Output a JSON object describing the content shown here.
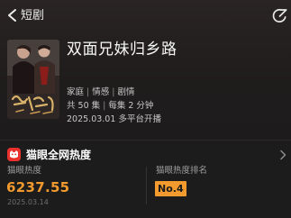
{
  "nav": {
    "title": "短剧"
  },
  "drama": {
    "title": "双面兄妹归乡路",
    "genres": [
      "家庭",
      "情感",
      "剧情"
    ],
    "episodes": "共 50 集",
    "duration": "每集 2 分钟",
    "release_date": "2025.03.01",
    "release_platform": "多平台开播"
  },
  "heat": {
    "section_title": "猫眼全网热度",
    "label_heat": "猫眼热度",
    "heat_value": "6237.55",
    "heat_date": "2025.03.14",
    "label_rank": "猫眼热度排名",
    "rank_value": "No.4"
  },
  "icons": {
    "back": "chevron-left-icon",
    "share": "share-icon",
    "logo": "maoyan-logo-icon",
    "more": "chevron-right-icon"
  },
  "colors": {
    "accent": "#f29a2e",
    "brand_red": "#e8312f",
    "background": "#1f1c1c"
  }
}
